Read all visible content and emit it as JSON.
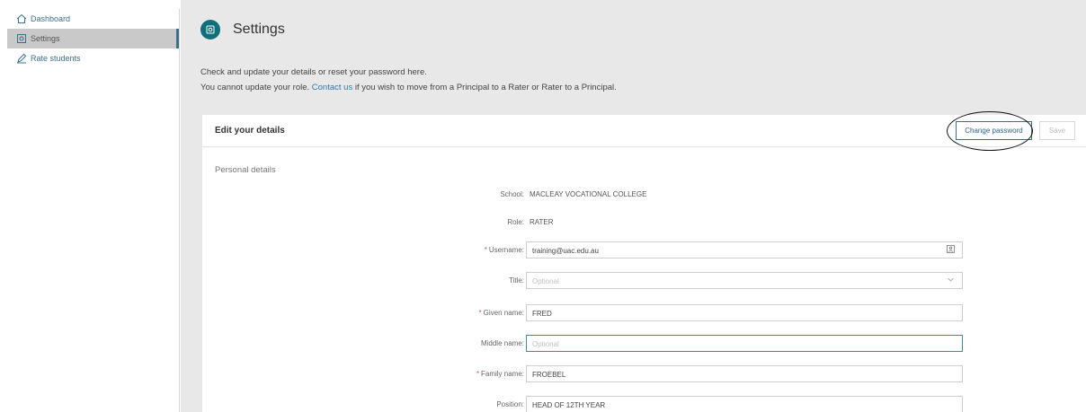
{
  "sidebar": {
    "items": [
      {
        "label": "Dashboard",
        "icon": "home-icon"
      },
      {
        "label": "Settings",
        "icon": "gear-icon"
      },
      {
        "label": "Rate students",
        "icon": "pencil-icon"
      }
    ]
  },
  "header": {
    "title": "Settings",
    "icon": "gear-icon"
  },
  "intro": {
    "line1": "Check and update your details or reset your password here.",
    "line2_before": "You cannot update your role.",
    "contact_link": "Contact us",
    "line2_after": "if you wish to move from a Principal to a Rater or Rater to a Principal."
  },
  "card": {
    "title": "Edit your details",
    "change_password_label": "Change password",
    "save_label": "Save",
    "section_title": "Personal details"
  },
  "fields": {
    "school": {
      "label": "School:",
      "value": "MACLEAY VOCATIONAL COLLEGE"
    },
    "role": {
      "label": "Role:",
      "value": "RATER"
    },
    "username": {
      "label": "Username:",
      "value": "training@uac.edu.au"
    },
    "title": {
      "label": "Title:",
      "placeholder": "Optional"
    },
    "given_name": {
      "label": "Given name:",
      "value": "FRED"
    },
    "middle_name": {
      "label": "Middle name:",
      "placeholder": "Optional"
    },
    "family_name": {
      "label": "Family name:",
      "value": "FROEBEL"
    },
    "position": {
      "label": "Position:",
      "value": "HEAD OF 12TH YEAR"
    }
  },
  "required_marker": "*",
  "colors": {
    "accent": "#0f6f7a",
    "link": "#2a7ab0",
    "required": "#d9534f"
  }
}
